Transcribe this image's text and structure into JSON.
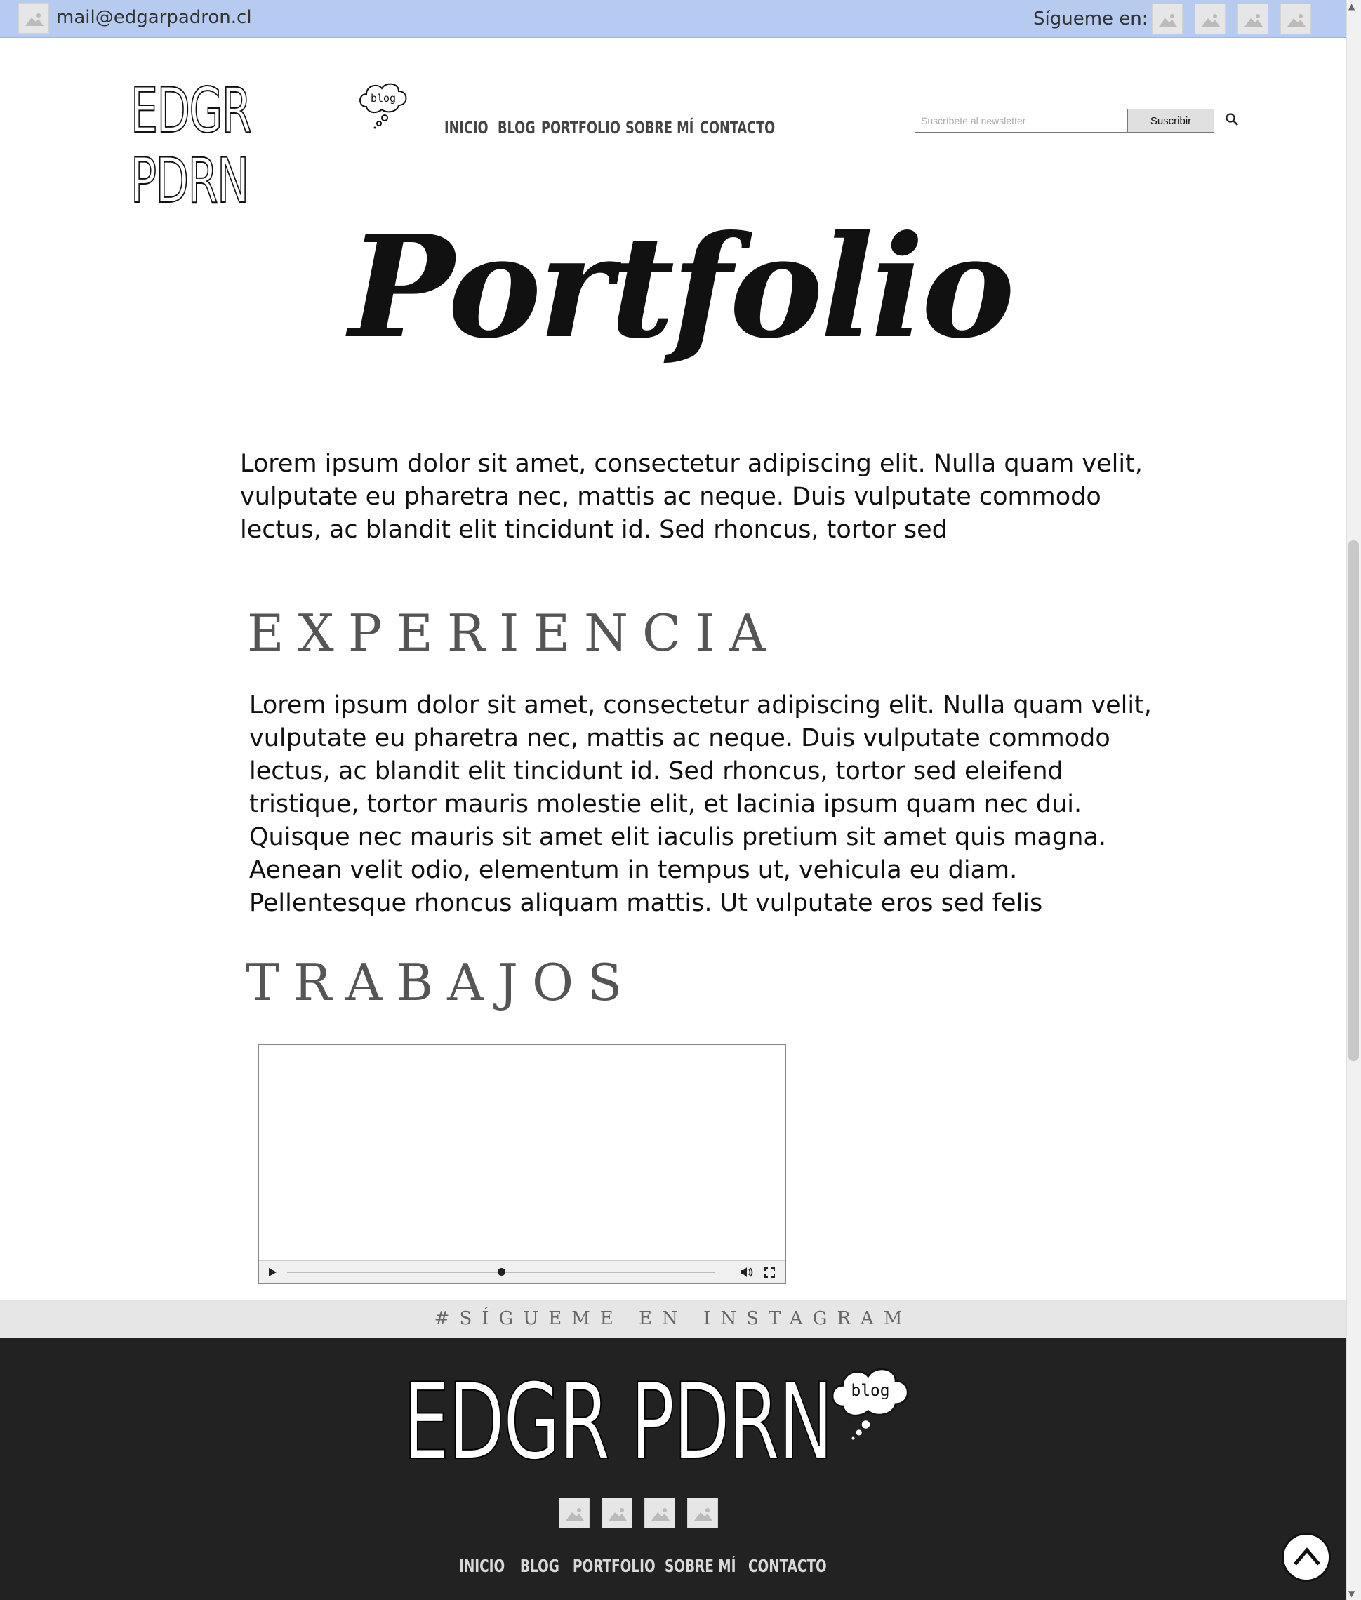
{
  "topbar": {
    "email": "mail@edgarpadron.cl",
    "follow_label": "Sígueme en:"
  },
  "header": {
    "logo_text": "EDGR PDRN",
    "logo_badge": "blog",
    "nav": [
      "INICIO",
      "BLOG",
      "PORTFOLIO",
      "SOBRE MÍ",
      "CONTACTO"
    ],
    "newsletter": {
      "placeholder": "Suscríbete al newsletter",
      "button": "Suscribir"
    }
  },
  "hero": {
    "title": "Portfolio",
    "intro": "Lorem ipsum dolor sit amet, consectetur adipiscing elit. Nulla quam velit, vulputate eu pharetra nec, mattis ac neque. Duis vulputate commodo lectus, ac blandit elit tincidunt id. Sed rhoncus, tortor sed"
  },
  "experience": {
    "title": "EXPERIENCIA",
    "body": "Lorem ipsum dolor sit amet, consectetur adipiscing elit. Nulla quam velit, vulputate eu pharetra nec, mattis ac neque. Duis vulputate commodo lectus, ac blandit elit tincidunt id. Sed rhoncus, tortor sed eleifend tristique, tortor mauris molestie elit, et lacinia ipsum quam nec dui. Quisque nec mauris sit amet elit iaculis pretium sit amet quis magna. Aenean velit odio, elementum in tempus ut, vehicula eu diam. Pellentesque rhoncus aliquam mattis. Ut vulputate eros sed felis"
  },
  "works": {
    "title": "TRABAJOS",
    "video": {
      "progress": 0.5
    }
  },
  "instagram": {
    "label": "#SÍGUEME EN INSTAGRAM"
  },
  "footer": {
    "logo_text": "EDGR PDRN",
    "logo_badge": "blog",
    "nav": [
      "INICIO",
      "BLOG",
      "PORTFOLIO",
      "SOBRE MÍ",
      "CONTACTO"
    ]
  },
  "colors": {
    "topbar_bg": "#b7cbf0",
    "footer_bg": "#222222",
    "instagram_band": "#e6e6e6"
  }
}
